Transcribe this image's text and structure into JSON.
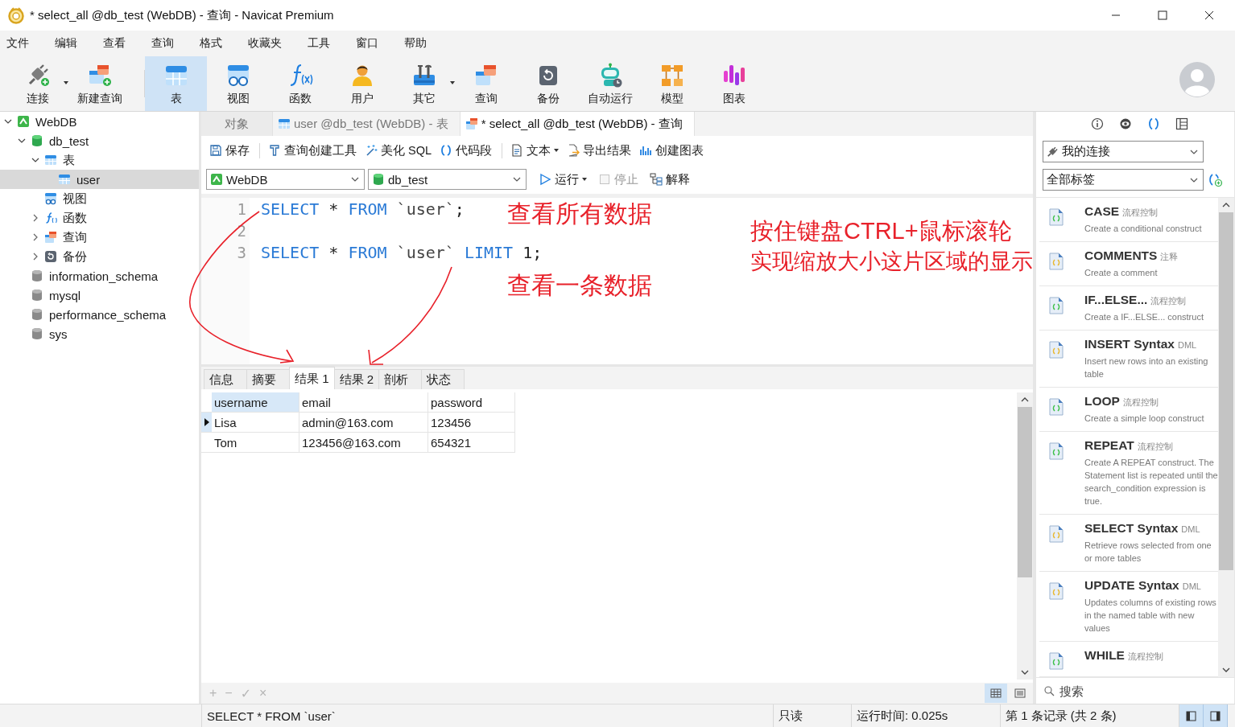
{
  "window": {
    "title": "* select_all @db_test (WebDB) - 查询 - Navicat Premium"
  },
  "menu": [
    "文件",
    "编辑",
    "查看",
    "查询",
    "格式",
    "收藏夹",
    "工具",
    "窗口",
    "帮助"
  ],
  "toolbar": [
    {
      "label": "连接",
      "kind": "connect",
      "dropdown": true,
      "selected": false
    },
    {
      "label": "新建查询",
      "kind": "newquery",
      "selected": false
    },
    {
      "label": "表",
      "kind": "table",
      "selected": true,
      "separator_before": true
    },
    {
      "label": "视图",
      "kind": "view",
      "selected": false
    },
    {
      "label": "函数",
      "kind": "function",
      "selected": false
    },
    {
      "label": "用户",
      "kind": "user",
      "selected": false
    },
    {
      "label": "其它",
      "kind": "tools",
      "dropdown": true,
      "selected": false
    },
    {
      "label": "查询",
      "kind": "query",
      "selected": false
    },
    {
      "label": "备份",
      "kind": "backup",
      "selected": false
    },
    {
      "label": "自动运行",
      "kind": "robot",
      "selected": false
    },
    {
      "label": "模型",
      "kind": "model",
      "selected": false
    },
    {
      "label": "图表",
      "kind": "chart",
      "selected": false
    }
  ],
  "navigator": {
    "items": [
      {
        "label": "WebDB",
        "kind": "connection",
        "expanded": true,
        "selected": false,
        "children": [
          {
            "label": "db_test",
            "kind": "database",
            "expanded": true,
            "selected": false,
            "children": [
              {
                "label": "表",
                "kind": "table",
                "expanded": true,
                "selected": false,
                "children": [
                  {
                    "label": "user",
                    "kind": "table",
                    "selected": true
                  }
                ]
              },
              {
                "label": "视图",
                "kind": "view",
                "selected": false
              },
              {
                "label": "函数",
                "kind": "function",
                "expanded": false,
                "selected": false
              },
              {
                "label": "查询",
                "kind": "query",
                "expanded": false,
                "selected": false
              },
              {
                "label": "备份",
                "kind": "backup",
                "expanded": false,
                "selected": false
              }
            ]
          },
          {
            "label": "information_schema",
            "kind": "database-closed",
            "selected": false
          },
          {
            "label": "mysql",
            "kind": "database-closed",
            "selected": false
          },
          {
            "label": "performance_schema",
            "kind": "database-closed",
            "selected": false
          },
          {
            "label": "sys",
            "kind": "database-closed",
            "selected": false
          }
        ]
      }
    ]
  },
  "editor_tabs": [
    {
      "label": "对象",
      "selected": false
    },
    {
      "label": "user @db_test (WebDB) - 表",
      "kind": "table",
      "selected": false
    },
    {
      "label": "* select_all @db_test (WebDB) - 查询",
      "kind": "query",
      "selected": true
    }
  ],
  "editor_toolbar": [
    {
      "label": "保存",
      "kind": "save"
    },
    {
      "label": "查询创建工具",
      "kind": "builder",
      "separator_before": true
    },
    {
      "label": "美化 SQL",
      "kind": "beautify"
    },
    {
      "label": "代码段",
      "kind": "snippet"
    },
    {
      "label": "文本",
      "kind": "text",
      "dropdown": true,
      "separator_before": true
    },
    {
      "label": "导出结果",
      "kind": "export"
    },
    {
      "label": "创建图表",
      "kind": "chart"
    }
  ],
  "selectors": {
    "connection": "WebDB",
    "database": "db_test"
  },
  "run_controls": [
    {
      "label": "运行",
      "kind": "run",
      "dropdown": true,
      "disabled": false
    },
    {
      "label": "停止",
      "kind": "stop",
      "disabled": true
    },
    {
      "label": "解释",
      "kind": "explain",
      "disabled": false
    }
  ],
  "code_lines": [
    {
      "number": "1",
      "tokens": [
        {
          "kind": "keyword",
          "text": "SELECT"
        },
        {
          "kind": "plain",
          "text": " * "
        },
        {
          "kind": "keyword",
          "text": "FROM"
        },
        {
          "kind": "ident",
          "text": " `user`"
        },
        {
          "kind": "plain",
          "text": ";"
        }
      ]
    },
    {
      "number": "2"
    },
    {
      "number": "3",
      "tokens": [
        {
          "kind": "keyword",
          "text": "SELECT"
        },
        {
          "kind": "plain",
          "text": " * "
        },
        {
          "kind": "keyword",
          "text": "FROM"
        },
        {
          "kind": "ident",
          "text": " `user` "
        },
        {
          "kind": "keyword",
          "text": "LIMIT"
        },
        {
          "kind": "number",
          "text": " 1"
        },
        {
          "kind": "plain",
          "text": ";"
        }
      ]
    }
  ],
  "annotations": [
    {
      "text": "查看所有数据"
    },
    {
      "text": "查看一条数据"
    },
    {
      "text": "按住键盘CTRL+鼠标滚轮"
    },
    {
      "text": "实现缩放大小这片区域的显示"
    }
  ],
  "result_tabs": [
    {
      "label": "信息",
      "selected": false
    },
    {
      "label": "摘要",
      "selected": false
    },
    {
      "label": "结果 1",
      "selected": true
    },
    {
      "label": "结果 2",
      "selected": false
    },
    {
      "label": "剖析",
      "selected": false
    },
    {
      "label": "状态",
      "selected": false
    }
  ],
  "grid": {
    "columns": [
      {
        "label": "username",
        "selected": true
      },
      {
        "label": "email",
        "selected": false
      },
      {
        "label": "password",
        "selected": false
      }
    ],
    "rows": [
      {
        "current": true,
        "cells": [
          "Lisa",
          "admin@163.com",
          "123456"
        ]
      },
      {
        "current": false,
        "cells": [
          "Tom",
          "123456@163.com",
          "654321"
        ]
      }
    ]
  },
  "grid_footer": {
    "actions": [
      "+",
      "−",
      "✓",
      "×"
    ],
    "views": [
      {
        "kind": "grid",
        "selected": true
      },
      {
        "kind": "form",
        "selected": false
      }
    ]
  },
  "snippet_panel": {
    "tabs": [
      {
        "kind": "info",
        "selected": false
      },
      {
        "kind": "eye",
        "selected": false
      },
      {
        "kind": "braces",
        "selected": true
      },
      {
        "kind": "columns",
        "selected": false
      }
    ],
    "connection": "我的连接",
    "tag_filter": "全部标签",
    "snippets": [
      {
        "title": "CASE",
        "tag": "流程控制",
        "description": "Create a conditional construct",
        "color": "#3ec04a"
      },
      {
        "title": "COMMENTS",
        "tag": "注释",
        "description": "Create a comment",
        "color": "#e8b830"
      },
      {
        "title": "IF...ELSE...",
        "tag": "流程控制",
        "description": "Create a IF...ELSE... construct",
        "color": "#3ec04a"
      },
      {
        "title": "INSERT Syntax",
        "tag": "DML",
        "description": "Insert new rows into an existing table",
        "color": "#e8b830"
      },
      {
        "title": "LOOP",
        "tag": "流程控制",
        "description": "Create a simple loop construct",
        "color": "#3ec04a"
      },
      {
        "title": "REPEAT",
        "tag": "流程控制",
        "description": "Create A REPEAT construct. The Statement list is repeated until the search_condition expression is true.",
        "color": "#3ec04a"
      },
      {
        "title": "SELECT Syntax",
        "tag": "DML",
        "description": "Retrieve rows selected from one or more tables",
        "color": "#e8b830"
      },
      {
        "title": "UPDATE Syntax",
        "tag": "DML",
        "description": "Updates columns of existing rows in the named table with new values",
        "color": "#e8b830"
      },
      {
        "title": "WHILE",
        "tag": "流程控制",
        "color": "#3ec04a"
      }
    ],
    "search": {
      "placeholder": "搜索"
    }
  },
  "status_bar": {
    "sql": "SELECT * FROM `user`",
    "mode": "只读",
    "elapsed": "运行时间: 0.025s",
    "record": "第 1 条记录 (共 2 条)",
    "layout_buttons": [
      {
        "kind": "left",
        "selected": true
      },
      {
        "kind": "right",
        "selected": true
      }
    ]
  }
}
